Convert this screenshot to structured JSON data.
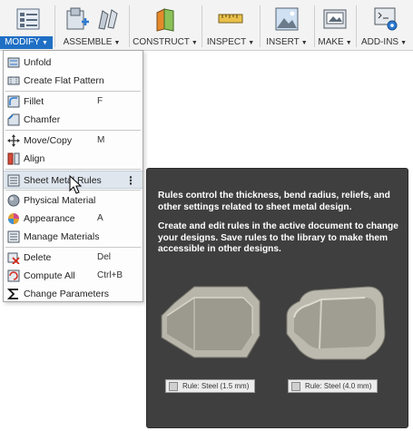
{
  "toolbar": {
    "groups": [
      {
        "label": "MODIFY",
        "icon": "modify-icon",
        "active": true
      },
      {
        "label": "ASSEMBLE",
        "icon": "assemble-icon"
      },
      {
        "label": "CONSTRUCT",
        "icon": "construct-plane-icon"
      },
      {
        "label": "INSPECT",
        "icon": "measure-icon"
      },
      {
        "label": "INSERT",
        "icon": "insert-image-icon"
      },
      {
        "label": "MAKE",
        "icon": "make-icon"
      },
      {
        "label": "ADD-INS",
        "icon": "scripts-icon"
      }
    ],
    "active_color": "#1f6fc5"
  },
  "menu": {
    "items": [
      {
        "label": "Unfold",
        "shortcut": "",
        "icon": "unfold-icon"
      },
      {
        "label": "Create Flat Pattern",
        "shortcut": "",
        "icon": "flat-pattern-icon"
      },
      {
        "label": "Fillet",
        "shortcut": "F",
        "icon": "fillet-icon"
      },
      {
        "label": "Chamfer",
        "shortcut": "",
        "icon": "chamfer-icon"
      },
      {
        "label": "Move/Copy",
        "shortcut": "M",
        "icon": "move-icon"
      },
      {
        "label": "Align",
        "shortcut": "",
        "icon": "align-icon"
      },
      {
        "label": "Sheet Metal Rules",
        "shortcut": "",
        "icon": "sheet-metal-rules-icon",
        "highlighted": true,
        "more": "⋮"
      },
      {
        "label": "Physical Material",
        "shortcut": "",
        "icon": "physical-material-icon"
      },
      {
        "label": "Appearance",
        "shortcut": "A",
        "icon": "appearance-icon"
      },
      {
        "label": "Manage Materials",
        "shortcut": "",
        "icon": "manage-materials-icon"
      },
      {
        "label": "Delete",
        "shortcut": "Del",
        "icon": "delete-icon"
      },
      {
        "label": "Compute All",
        "shortcut": "Ctrl+B",
        "icon": "compute-all-icon"
      },
      {
        "label": "Change Parameters",
        "shortcut": "",
        "icon": "sigma-icon"
      }
    ]
  },
  "tooltip": {
    "paragraph1": "Rules control the thickness, bend radius, reliefs, and other settings related to sheet metal design.",
    "paragraph2": "Create and edit rules in the active document to change your designs. Save rules to the library to make them accessible in other designs.",
    "tag1": "Rule: Steel (1.5 mm)",
    "tag2": "Rule: Steel (4.0 mm)"
  }
}
